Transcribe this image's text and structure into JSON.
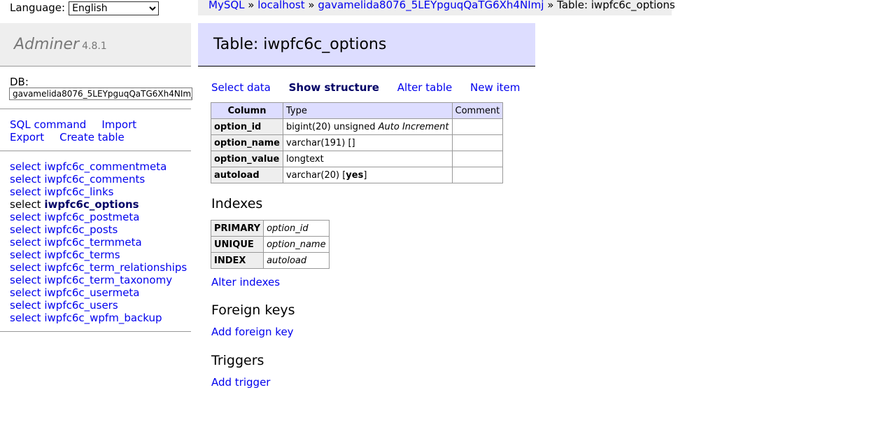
{
  "language": {
    "label": "Language:",
    "selected": "English"
  },
  "breadcrumb": {
    "items": [
      "MySQL",
      "localhost",
      "gavamelida8076_5LEYpguqQaTG6Xh4NImj"
    ],
    "separator": "»",
    "current": "Table: iwpfc6c_options"
  },
  "app": {
    "name": "Adminer",
    "version": "4.8.1"
  },
  "db": {
    "label": "DB:",
    "selected": "gavamelida8076_5LEYpguqQaTG6Xh4NImj"
  },
  "commands": [
    "SQL command",
    "Import",
    "Export",
    "Create table"
  ],
  "tables": {
    "prefix": "select",
    "items": [
      "iwpfc6c_commentmeta",
      "iwpfc6c_comments",
      "iwpfc6c_links",
      "iwpfc6c_options",
      "iwpfc6c_postmeta",
      "iwpfc6c_posts",
      "iwpfc6c_termmeta",
      "iwpfc6c_terms",
      "iwpfc6c_term_relationships",
      "iwpfc6c_term_taxonomy",
      "iwpfc6c_usermeta",
      "iwpfc6c_users",
      "iwpfc6c_wpfm_backup"
    ],
    "active_index": 3
  },
  "page": {
    "title": "Table: iwpfc6c_options",
    "links": [
      "Select data",
      "Show structure",
      "Alter table",
      "New item"
    ],
    "current_link_index": 1
  },
  "structure": {
    "headers": [
      "Column",
      "Type",
      "Comment"
    ],
    "rows": [
      {
        "column": "option_id",
        "type": "bigint(20) unsigned",
        "extra": "Auto Increment",
        "comment": ""
      },
      {
        "column": "option_name",
        "type": "varchar(191) []",
        "comment": ""
      },
      {
        "column": "option_value",
        "type": "longtext",
        "comment": ""
      },
      {
        "column": "autoload",
        "type_before": "varchar(20) [",
        "type_default": "yes",
        "type_after": "]",
        "comment": ""
      }
    ]
  },
  "indexes": {
    "heading": "Indexes",
    "rows": [
      {
        "type": "PRIMARY",
        "column": "option_id"
      },
      {
        "type": "UNIQUE",
        "column": "option_name"
      },
      {
        "type": "INDEX",
        "column": "autoload"
      }
    ],
    "alter_link": "Alter indexes"
  },
  "foreign_keys": {
    "heading": "Foreign keys",
    "add_link": "Add foreign key"
  },
  "triggers": {
    "heading": "Triggers",
    "add_link": "Add trigger"
  }
}
